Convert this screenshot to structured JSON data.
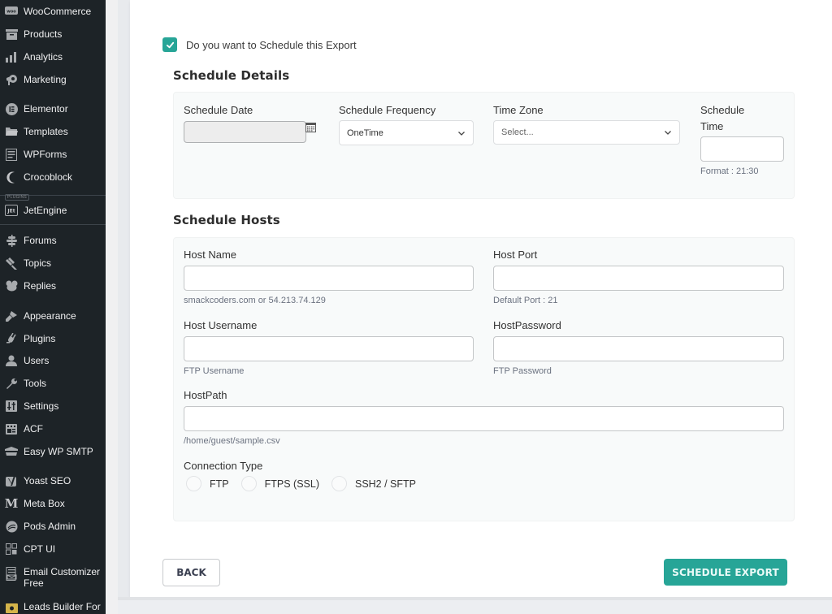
{
  "sidebar": {
    "plugins_tag": "PLUGINS",
    "items": [
      {
        "label": "WooCommerce",
        "icon": "woo-icon"
      },
      {
        "label": "Products",
        "icon": "archive-icon"
      },
      {
        "label": "Analytics",
        "icon": "bar-chart-icon"
      },
      {
        "label": "Marketing",
        "icon": "megaphone-icon"
      },
      {
        "label": "Elementor",
        "icon": "elementor-icon"
      },
      {
        "label": "Templates",
        "icon": "folder-icon"
      },
      {
        "label": "WPForms",
        "icon": "form-icon"
      },
      {
        "label": "Crocoblock",
        "icon": "crescent-icon"
      },
      {
        "label": "JetEngine",
        "icon": "jet-icon"
      },
      {
        "label": "Forums",
        "icon": "forums-icon"
      },
      {
        "label": "Topics",
        "icon": "topics-icon"
      },
      {
        "label": "Replies",
        "icon": "replies-icon"
      },
      {
        "label": "Appearance",
        "icon": "paintbrush-icon"
      },
      {
        "label": "Plugins",
        "icon": "plug-icon"
      },
      {
        "label": "Users",
        "icon": "user-icon"
      },
      {
        "label": "Tools",
        "icon": "wrench-icon"
      },
      {
        "label": "Settings",
        "icon": "sliders-icon"
      },
      {
        "label": "ACF",
        "icon": "acf-icon"
      },
      {
        "label": "Easy WP SMTP",
        "icon": "mail-icon"
      },
      {
        "label": "Yoast SEO",
        "icon": "yoast-icon"
      },
      {
        "label": "Meta Box",
        "icon": "metabox-icon"
      },
      {
        "label": "Pods Admin",
        "icon": "pods-icon"
      },
      {
        "label": "CPT UI",
        "icon": "grid-icon"
      },
      {
        "label": "Email Customizer Free",
        "icon": "email-customizer-icon"
      },
      {
        "label": "Leads Builder For",
        "icon": "leads-icon"
      }
    ]
  },
  "schedule_toggle": {
    "label": "Do you want to Schedule this Export",
    "checked": true
  },
  "schedule_details": {
    "title": "Schedule Details",
    "date_label": "Schedule Date",
    "date_value": "",
    "frequency_label": "Schedule Frequency",
    "frequency_value": "OneTime",
    "timezone_label": "Time Zone",
    "timezone_placeholder": "Select...",
    "time_label_line1": "Schedule",
    "time_label_line2": "Time",
    "time_value": "",
    "time_hint": "Format : 21:30"
  },
  "schedule_hosts": {
    "title": "Schedule Hosts",
    "host_name_label": "Host Name",
    "host_name_value": "",
    "host_name_hint": "smackcoders.com or 54.213.74.129",
    "host_port_label": "Host Port",
    "host_port_value": "",
    "host_port_hint": "Default Port : 21",
    "host_username_label": "Host Username",
    "host_username_value": "",
    "host_username_hint": "FTP Username",
    "host_password_label": "HostPassword",
    "host_password_value": "",
    "host_password_hint": "FTP Password",
    "host_path_label": "HostPath",
    "host_path_value": "",
    "host_path_hint": "/home/guest/sample.csv",
    "connection_type_label": "Connection Type",
    "connection_options": [
      "FTP",
      "FTPS (SSL)",
      "SSH2 / SFTP"
    ]
  },
  "buttons": {
    "back": "BACK",
    "schedule_export": "SCHEDULE EXPORT"
  },
  "colors": {
    "accent": "#27a597",
    "sidebar_bg": "#1d2327"
  }
}
